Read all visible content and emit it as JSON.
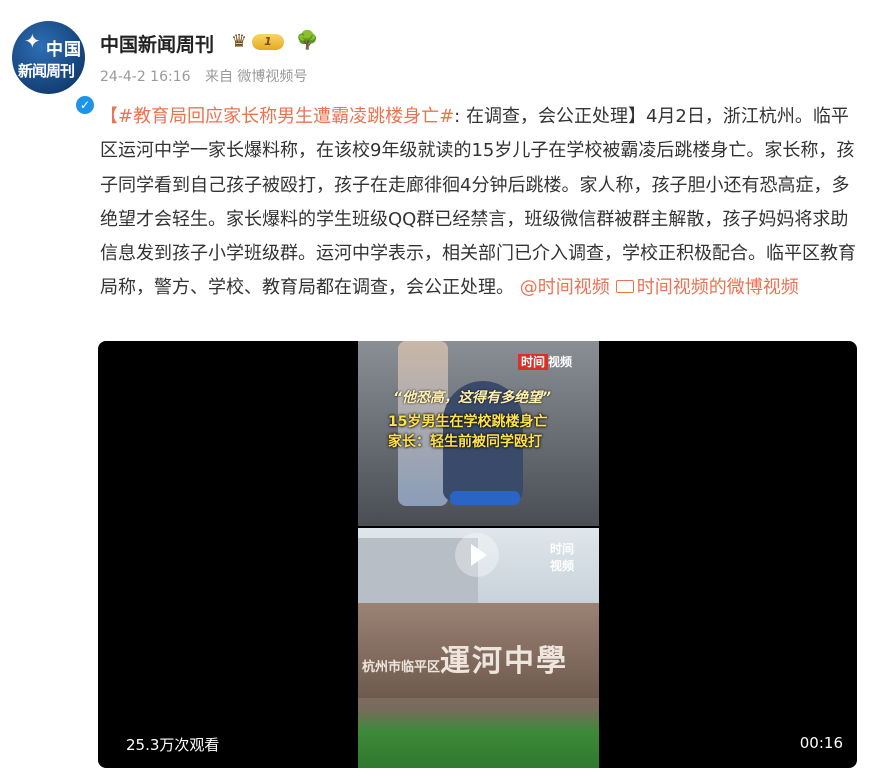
{
  "header": {
    "avatar_lines": [
      "中国",
      "新闻周刊"
    ],
    "username": "中国新闻周刊",
    "level_badge": "1",
    "meta_date": "24-4-2 16:16",
    "meta_source": "来自 微博视频号"
  },
  "post": {
    "topic": "【#教育局回应家长称男生遭霸凌跳楼身亡#",
    "text": ": 在调查，会公正处理】4月2日，浙江杭州。临平区运河中学一家长爆料称，在该校9年级就读的15岁儿子在学校被霸凌后跳楼身亡。家长称，孩子同学看到自己孩子被殴打，孩子在走廊徘徊4分钟后跳楼。家人称，孩子胆小还有恐高症，多绝望才会轻生。家长爆料的学生班级QQ群已经禁言，班级微信群被群主解散，孩子妈妈将求助信息发到孩子小学班级群。运河中学表示，相关部门已介入调查，学校正积极配合。临平区教育局称，警方、学校、教育局都在调查，会公正处理。",
    "mention": "@时间视频",
    "video_link": "时间视频的微博视频"
  },
  "video": {
    "watermark_1": "时间",
    "watermark_2": "视频",
    "caption_quote": "“他恐高，这得有多绝望”",
    "caption_line1": "15岁男生在学校跳楼身亡",
    "caption_line2": "家长：轻生前被同学殴打",
    "school_small": "杭州市临平区",
    "school_big": "運河中學",
    "views": "25.3万次观看",
    "duration": "00:16"
  },
  "colors": {
    "link": "#eb7350",
    "verified": "#1e94e8",
    "brand_red": "#d9302a"
  }
}
